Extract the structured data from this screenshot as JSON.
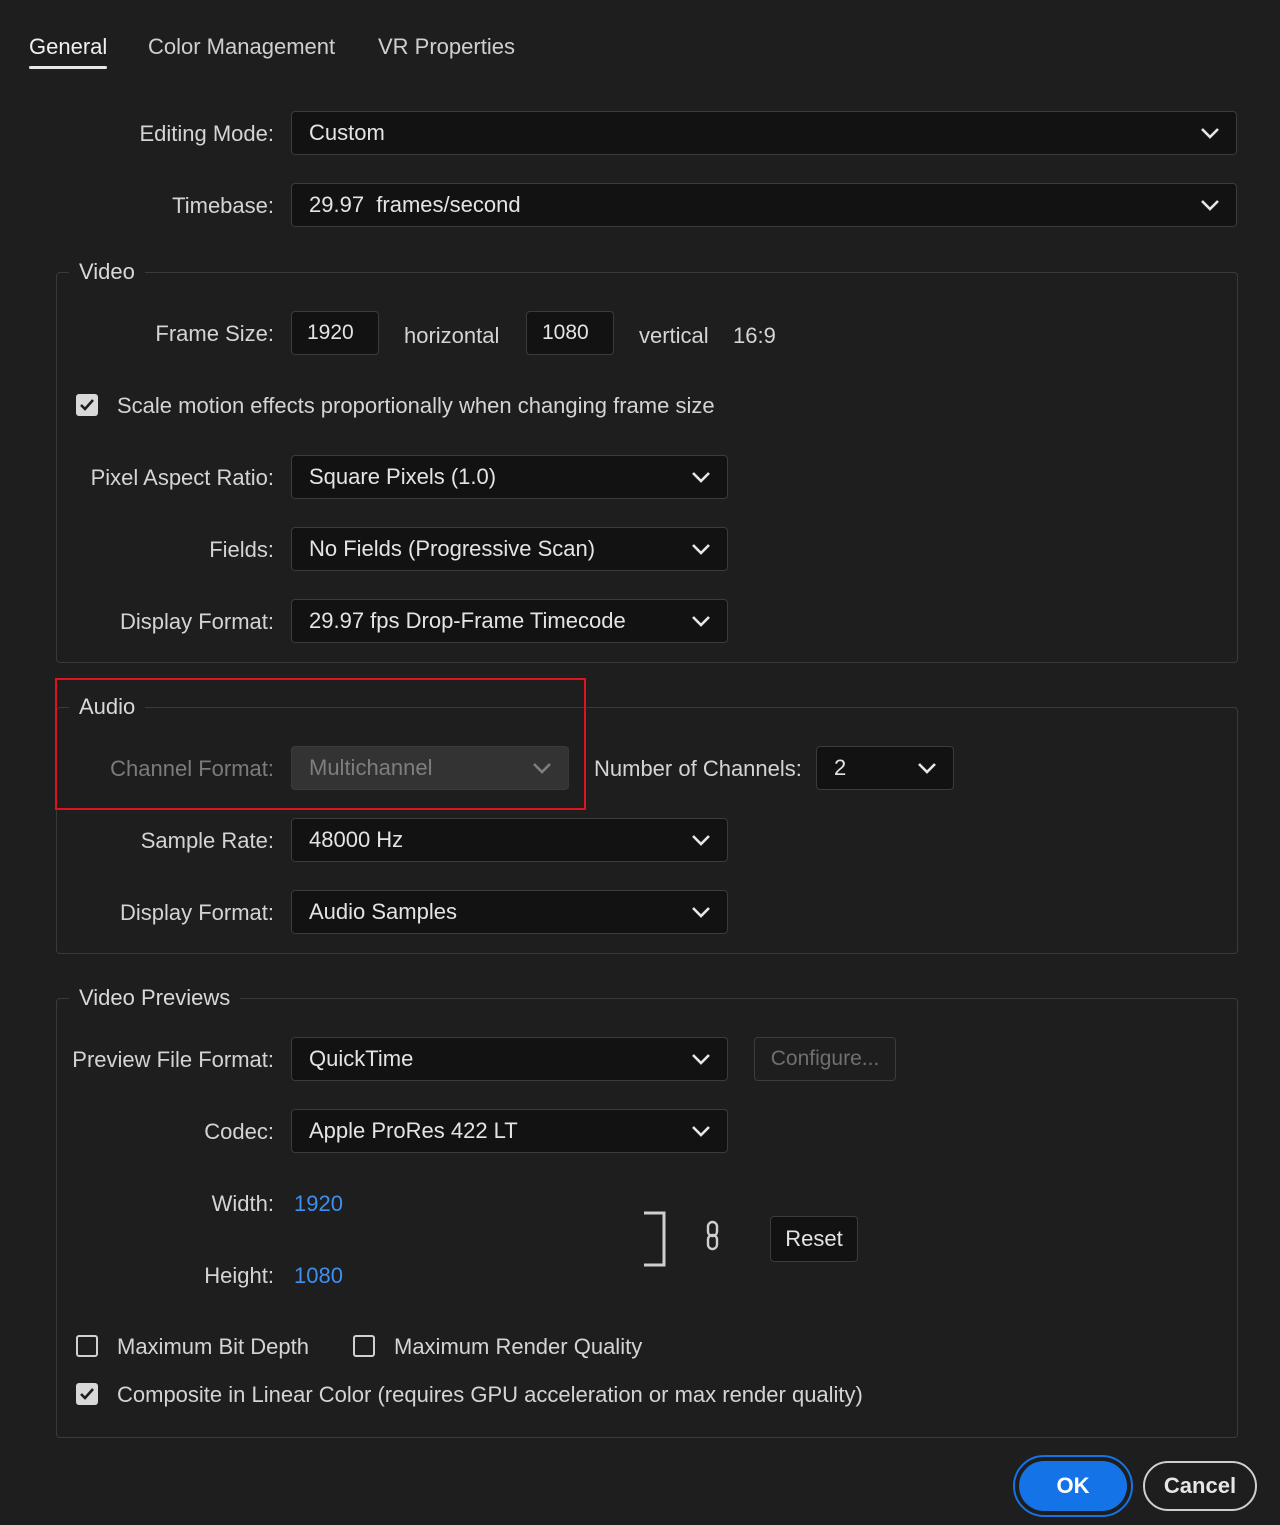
{
  "tabs": [
    {
      "label": "General"
    },
    {
      "label": "Color Management"
    },
    {
      "label": "VR Properties"
    }
  ],
  "general": {
    "editing_mode_label": "Editing Mode:",
    "editing_mode_value": "Custom",
    "timebase_label": "Timebase:",
    "timebase_value": "29.97  frames/second"
  },
  "video": {
    "legend": "Video",
    "frame_size_label": "Frame Size:",
    "frame_width": "1920",
    "horizontal_label": "horizontal",
    "frame_height": "1080",
    "vertical_label": "vertical",
    "aspect": "16:9",
    "scale_motion_label": "Scale motion effects proportionally when changing frame size",
    "scale_motion_checked": true,
    "pixel_aspect_label": "Pixel Aspect Ratio:",
    "pixel_aspect_value": "Square Pixels (1.0)",
    "fields_label": "Fields:",
    "fields_value": "No Fields (Progressive Scan)",
    "display_format_label": "Display Format:",
    "display_format_value": "29.97 fps Drop-Frame Timecode"
  },
  "audio": {
    "legend": "Audio",
    "channel_format_label": "Channel Format:",
    "channel_format_value": "Multichannel",
    "channels_label": "Number of Channels:",
    "channels_value": "2",
    "sample_rate_label": "Sample Rate:",
    "sample_rate_value": "48000 Hz",
    "display_format_label": "Display Format:",
    "display_format_value": "Audio Samples"
  },
  "previews": {
    "legend": "Video Previews",
    "file_format_label": "Preview File Format:",
    "file_format_value": "QuickTime",
    "configure_label": "Configure...",
    "codec_label": "Codec:",
    "codec_value": "Apple ProRes 422 LT",
    "width_label": "Width:",
    "width_value": "1920",
    "height_label": "Height:",
    "height_value": "1080",
    "reset_label": "Reset",
    "max_bit_depth_label": "Maximum Bit Depth",
    "max_render_quality_label": "Maximum Render Quality",
    "linear_color_label": "Composite in Linear Color (requires GPU acceleration or max render quality)"
  },
  "footer": {
    "ok_label": "OK",
    "cancel_label": "Cancel"
  },
  "colors": {
    "background": "#1e1e1e",
    "accent": "#1473e6",
    "link": "#3e8ff2",
    "highlight_box": "#e0121b"
  }
}
